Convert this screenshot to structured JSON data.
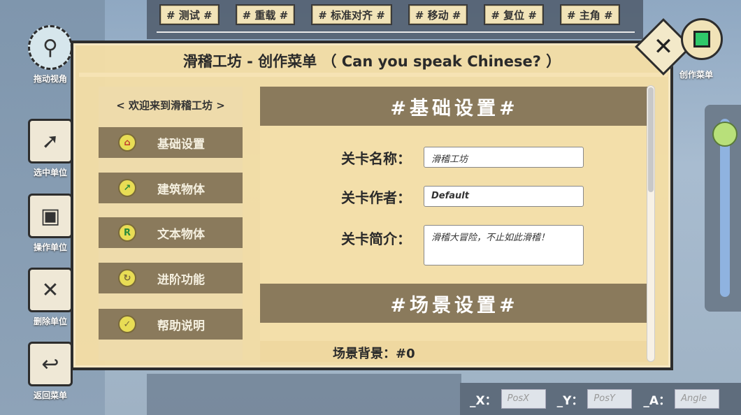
{
  "toolbar": {
    "buttons": [
      "# 测试 #",
      "# 重载 #",
      "# 标准对齐 #",
      "# 移动 #",
      "# 复位 #",
      "# 主角 #"
    ]
  },
  "tools": [
    {
      "label": "拖动视角",
      "icon": "drag-view-icon"
    },
    {
      "label": "选中单位",
      "icon": "cursor-select-icon"
    },
    {
      "label": "操作单位",
      "icon": "operate-unit-icon"
    },
    {
      "label": "删除单位",
      "icon": "delete-icon"
    },
    {
      "label": "返回菜单",
      "icon": "return-icon"
    }
  ],
  "create_menu": {
    "label": "创作菜单",
    "icon": "cube-icon"
  },
  "close_icon": "close-icon",
  "dialog": {
    "title": "滑稽工坊 - 创作菜单 （ Can you speak Chinese? ）",
    "welcome": "< 欢迎来到滑稽工坊 >",
    "menu": [
      {
        "label": "基础设置",
        "icon": "house-icon"
      },
      {
        "label": "建筑物体",
        "icon": "build-arrow-icon"
      },
      {
        "label": "文本物体",
        "icon": "text-r-icon"
      },
      {
        "label": "进阶功能",
        "icon": "refresh-circle-icon"
      },
      {
        "label": "帮助说明",
        "icon": "check-icon"
      }
    ],
    "section_basic": "#基础设置#",
    "fields": {
      "level_name_label": "关卡名称：",
      "level_name_value": "滑稽工坊",
      "level_author_label": "关卡作者：",
      "level_author_value": "Default",
      "level_desc_label": "关卡简介：",
      "level_desc_value": "滑稽大冒险，不止如此滑稽！"
    },
    "section_scene": "#场景设置#",
    "scene_background": "场景背景：#0"
  },
  "coords": {
    "x_label": "_X：",
    "x_placeholder": "PosX",
    "y_label": "_Y：",
    "y_placeholder": "PosY",
    "a_label": "_A：",
    "a_placeholder": "Angle"
  },
  "colors": {
    "panel_bg": "#f4dea5",
    "menu_item_bg": "#8a7a5c",
    "create_cube": "#2fc96a",
    "slider_knob": "#b8e07a"
  }
}
